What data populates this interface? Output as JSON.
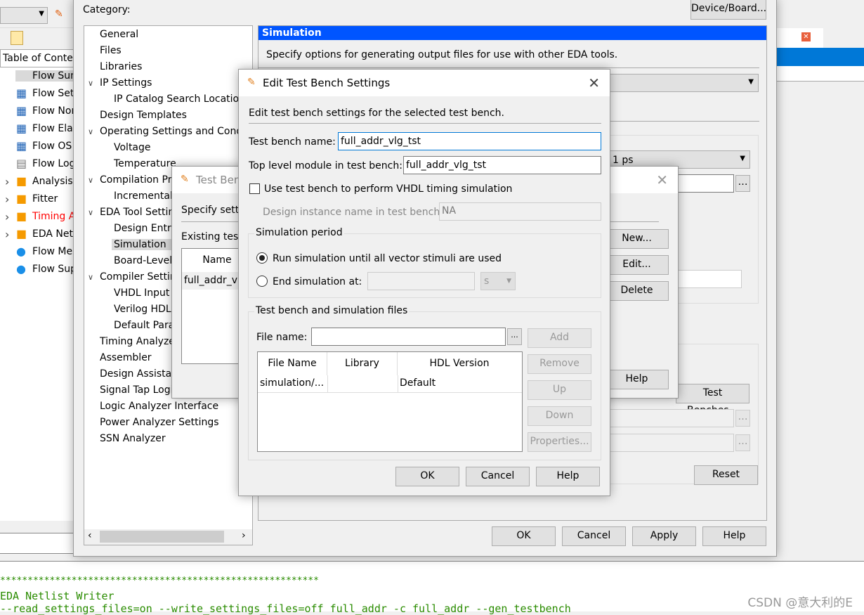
{
  "background": {
    "toc_header": "Table of Contents",
    "toc_items": [
      {
        "label": "Flow Summary",
        "icon": "table-icon"
      },
      {
        "label": "Flow Settings",
        "icon": "table-icon"
      },
      {
        "label": "Flow Non-Default Global Settings",
        "icon": "table-icon"
      },
      {
        "label": "Flow Elapsed Time",
        "icon": "table-icon"
      },
      {
        "label": "Flow OS Summary",
        "icon": "table-icon"
      },
      {
        "label": "Flow Log",
        "icon": "document-icon"
      },
      {
        "label": "Analysis & Synthesis",
        "icon": "folder-icon"
      },
      {
        "label": "Fitter",
        "icon": "folder-icon"
      },
      {
        "label": "Timing Analyzer",
        "icon": "folder-icon",
        "color": "#ff0000"
      },
      {
        "label": "EDA Netlist Writer",
        "icon": "folder-icon"
      },
      {
        "label": "Flow Messages",
        "icon": "info-icon"
      },
      {
        "label": "Flow Suppressed Messages",
        "icon": "info-icon"
      }
    ],
    "log_lines": [
      "**********************************************************",
      " EDA Netlist Writer",
      "--read_settings_files=on --write_settings_files=off full_addr -c full_addr --gen_testbench"
    ],
    "watermark": "CSDN @意大利的E"
  },
  "settings": {
    "category_label": "Category:",
    "device_board_button": "Device/Board...",
    "tree": [
      {
        "label": "General",
        "level": 0
      },
      {
        "label": "Files",
        "level": 0
      },
      {
        "label": "Libraries",
        "level": 0
      },
      {
        "label": "IP Settings",
        "level": 0,
        "expanded": true
      },
      {
        "label": "IP Catalog Search Locations",
        "level": 1
      },
      {
        "label": "Design Templates",
        "level": 0
      },
      {
        "label": "Operating Settings and Conditions",
        "level": 0,
        "expanded": true
      },
      {
        "label": "Voltage",
        "level": 1
      },
      {
        "label": "Temperature",
        "level": 1
      },
      {
        "label": "Compilation Process Settings",
        "level": 0,
        "expanded": true
      },
      {
        "label": "Incremental Compilation",
        "level": 1
      },
      {
        "label": "EDA Tool Settings",
        "level": 0,
        "expanded": true
      },
      {
        "label": "Design Entry/Synthesis",
        "level": 1
      },
      {
        "label": "Simulation",
        "level": 1,
        "selected": true
      },
      {
        "label": "Board-Level",
        "level": 1
      },
      {
        "label": "Compiler Settings",
        "level": 0,
        "expanded": true
      },
      {
        "label": "VHDL Input",
        "level": 1
      },
      {
        "label": "Verilog HDL Input",
        "level": 1
      },
      {
        "label": "Default Parameters",
        "level": 1
      },
      {
        "label": "Timing Analyzer",
        "level": 0
      },
      {
        "label": "Assembler",
        "level": 0
      },
      {
        "label": "Design Assistant",
        "level": 0
      },
      {
        "label": "Signal Tap Logic Analyzer",
        "level": 0
      },
      {
        "label": "Logic Analyzer Interface",
        "level": 0
      },
      {
        "label": "Power Analyzer Settings",
        "level": 0
      },
      {
        "label": "SSN Analyzer",
        "level": 0
      }
    ],
    "panel_title": "Simulation",
    "panel_desc": "Specify options for generating output files for use with other EDA tools.",
    "time_scale_value": "1 ps",
    "test_benches_button": "Test Benches...",
    "reset_button": "Reset",
    "ok": "OK",
    "cancel": "Cancel",
    "apply": "Apply",
    "help": "Help",
    "accent_color": "#0055ff"
  },
  "test_benches_dialog": {
    "title": "Test Benches",
    "desc": "Specify settings for each test bench.",
    "existing_label": "Existing test bench settings:",
    "col_name": "Name",
    "rows": [
      "full_addr_vlg_tst"
    ],
    "new": "New...",
    "edit": "Edit...",
    "delete": "Delete",
    "help": "Help"
  },
  "edit_dialog": {
    "title": "Edit Test Bench Settings",
    "desc": "Edit test bench settings for the selected test bench.",
    "tb_name_label": "Test bench name:",
    "tb_name_value": "full_addr_vlg_tst",
    "top_module_label": "Top level module in test bench:",
    "top_module_value": "full_addr_vlg_tst",
    "vhdl_timing_label": "Use test bench to perform VHDL timing simulation",
    "vhdl_timing_checked": false,
    "instance_label": "Design instance name in test bench:",
    "instance_value": "NA",
    "sim_period_title": "Simulation period",
    "run_all_label": "Run simulation until all vector stimuli are used",
    "end_at_label": "End simulation at:",
    "end_at_value": "",
    "end_unit": "s",
    "selected_period": "run_all",
    "files_title": "Test bench and simulation files",
    "file_name_label": "File name:",
    "file_name_value": "",
    "browse": "...",
    "columns": [
      "File Name",
      "Library",
      "HDL Version"
    ],
    "files": [
      {
        "file": "simulation/...",
        "library": "",
        "hdl": "Default"
      }
    ],
    "add": "Add",
    "remove": "Remove",
    "up": "Up",
    "down": "Down",
    "properties": "Properties...",
    "ok": "OK",
    "cancel": "Cancel",
    "help": "Help"
  }
}
